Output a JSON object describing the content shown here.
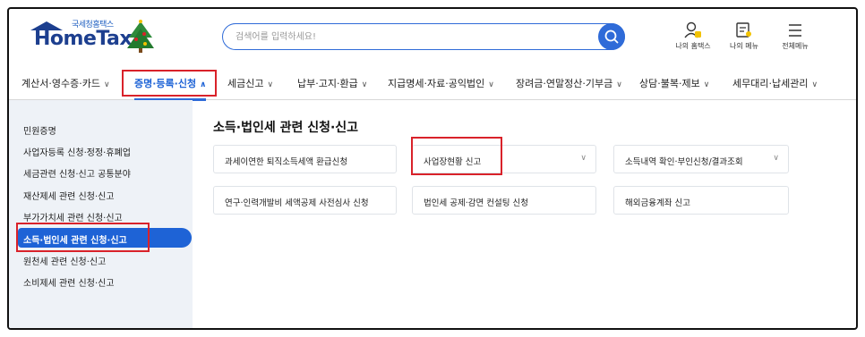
{
  "logo": {
    "top_text": "국세청홈택스",
    "brand": "HomeTax"
  },
  "search": {
    "placeholder": "검색어를 입력하세요!"
  },
  "header_icons": {
    "my_hometax": "나의 홈택스",
    "my_menu": "나의 메뉴",
    "all_menu": "전체메뉴"
  },
  "nav": {
    "items": [
      {
        "label": "계산서·영수증·카드"
      },
      {
        "label": "증명·등록·신청"
      },
      {
        "label": "세금신고"
      },
      {
        "label": "납부·고지·환급"
      },
      {
        "label": "지급명세·자료·공익법인"
      },
      {
        "label": "장려금·연말정산·기부금"
      },
      {
        "label": "상담·불복·제보"
      },
      {
        "label": "세무대리·납세관리"
      }
    ],
    "chevron_down": "∨",
    "chevron_up": "∧"
  },
  "sidebar": {
    "items": [
      {
        "label": "민원증명"
      },
      {
        "label": "사업자등록 신청·정정·휴폐업"
      },
      {
        "label": "세금관련 신청·신고 공통분야"
      },
      {
        "label": "재산제세 관련 신청·신고"
      },
      {
        "label": "부가가치세 관련 신청·신고"
      },
      {
        "label": "소득·법인세 관련 신청·신고"
      },
      {
        "label": "원천세 관련 신청·신고"
      },
      {
        "label": "소비제세 관련 신청·신고"
      }
    ],
    "active_index": 5
  },
  "main": {
    "title": "소득·법인세 관련 신청·신고",
    "cards": [
      {
        "label": "과세이연한 퇴직소득세액 환급신청",
        "has_chevron": false
      },
      {
        "label": "사업장현황 신고",
        "has_chevron": true
      },
      {
        "label": "소득내역 확인·부인신청/결과조회",
        "has_chevron": true
      },
      {
        "label": "연구·인력개발비 세액공제 사전심사 신청",
        "has_chevron": false
      },
      {
        "label": "법인세 공제·감면 컨설팅 신청",
        "has_chevron": false
      },
      {
        "label": "해외금융계좌 신고",
        "has_chevron": false
      }
    ],
    "card_chevron": "∨"
  },
  "colors": {
    "accent": "#1e63d6",
    "highlight": "#d9222a",
    "brand": "#1d3f8f"
  }
}
